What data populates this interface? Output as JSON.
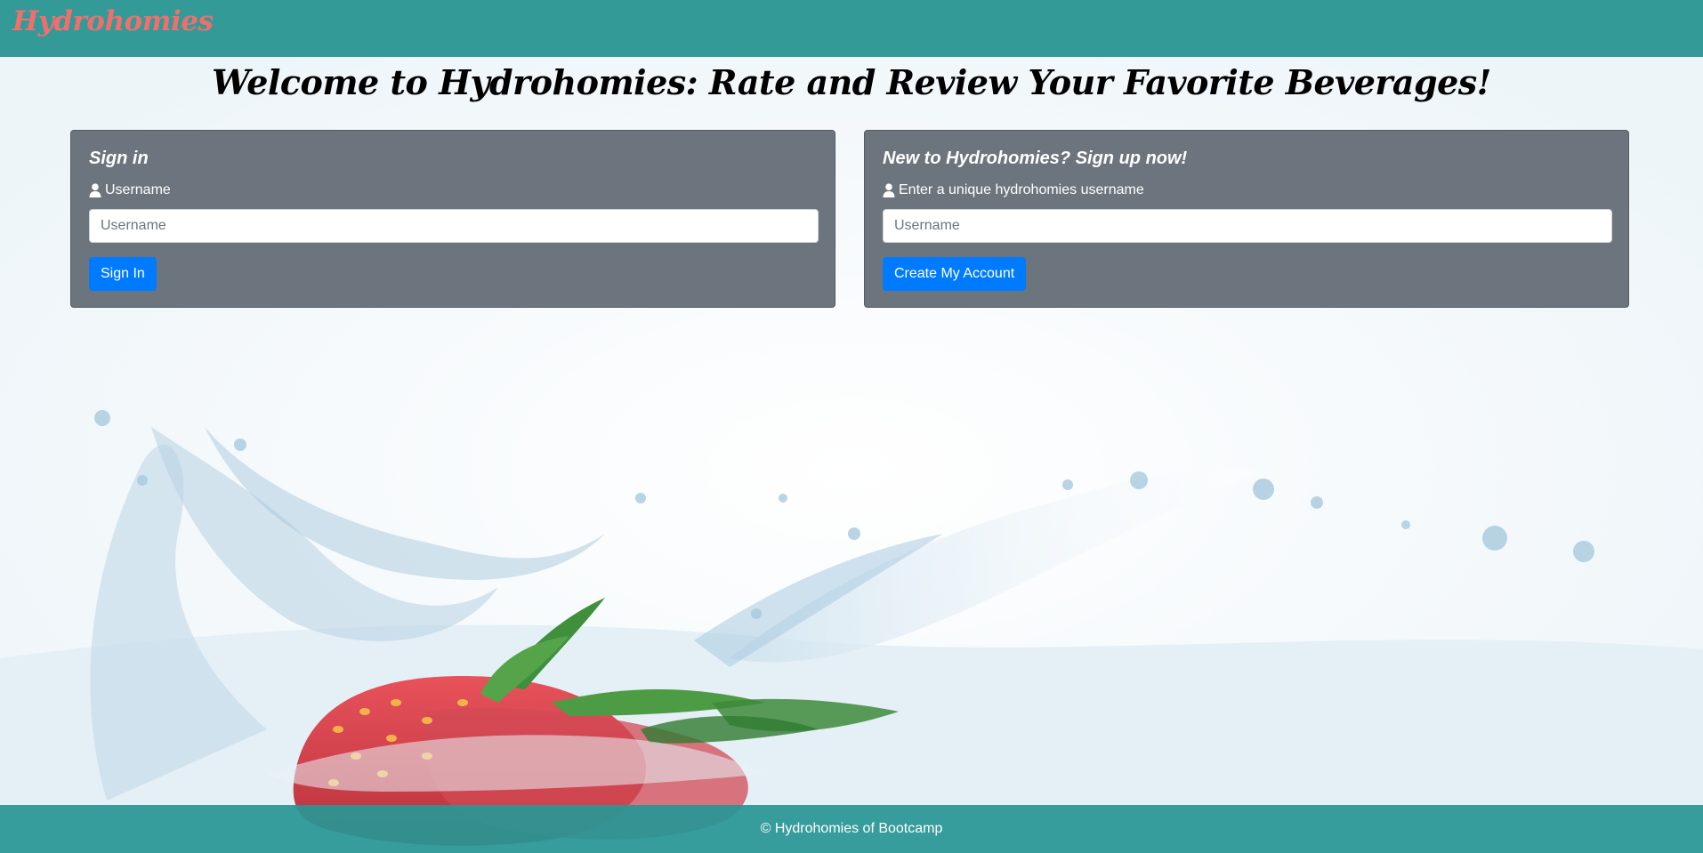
{
  "navbar": {
    "brand": "Hydrohomies"
  },
  "main": {
    "heading": "Welcome to Hydrohomies: Rate and Review Your Favorite Beverages!"
  },
  "signin": {
    "title": "Sign in",
    "label": "Username",
    "placeholder": "Username",
    "button": "Sign In"
  },
  "signup": {
    "title": "New to Hydrohomies? Sign up now!",
    "label": "Enter a unique hydrohomies username",
    "placeholder": "Username",
    "button": "Create My Account"
  },
  "footer": {
    "text": "© Hydrohomies of Bootcamp"
  },
  "icons": {
    "user": "user-icon"
  },
  "colors": {
    "navbar": "#339a98",
    "brand": "#ef6f6c",
    "card": "#6c757d",
    "button": "#007bff",
    "footer": "#299694"
  }
}
